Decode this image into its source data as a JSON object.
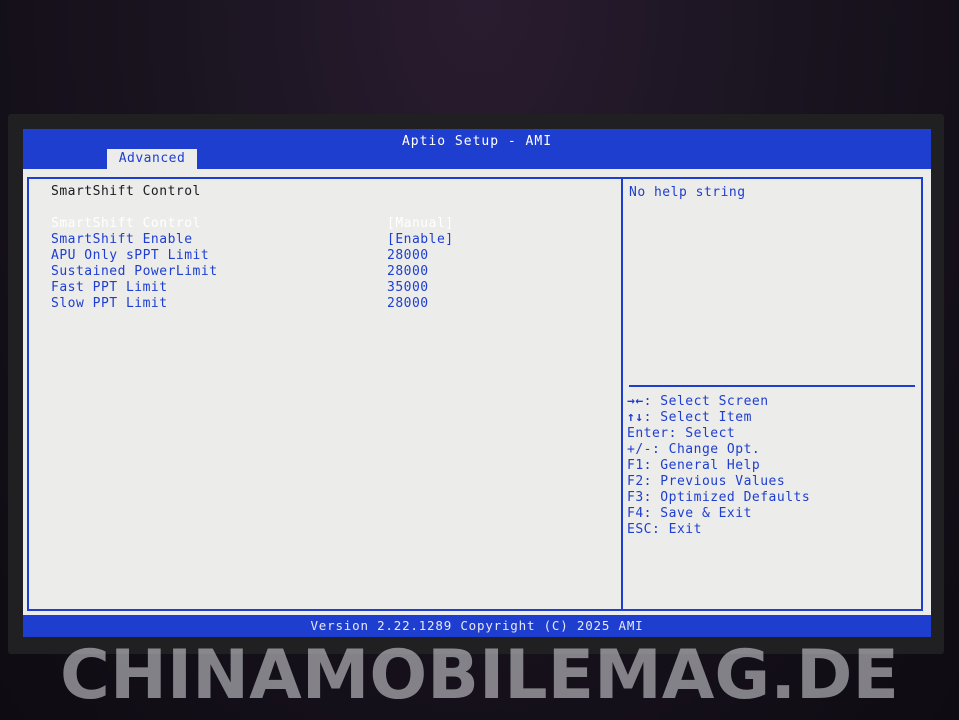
{
  "window": {
    "title": "Aptio Setup - AMI"
  },
  "tabs": [
    {
      "label": "Advanced",
      "active": true
    }
  ],
  "main": {
    "section_title": "SmartShift Control",
    "settings": [
      {
        "label": "SmartShift Control",
        "value": "[Manual]",
        "selected": true
      },
      {
        "label": "SmartShift Enable",
        "value": "[Enable]",
        "selected": false
      },
      {
        "label": "APU Only sPPT Limit",
        "value": "28000",
        "selected": false
      },
      {
        "label": "Sustained PowerLimit",
        "value": "28000",
        "selected": false
      },
      {
        "label": "Fast PPT Limit",
        "value": "35000",
        "selected": false
      },
      {
        "label": "Slow PPT Limit",
        "value": "28000",
        "selected": false
      }
    ]
  },
  "help": {
    "text": "No help string",
    "keys": [
      {
        "key": "→←",
        "desc": ": Select Screen",
        "icon": "arrows-left-right-icon"
      },
      {
        "key": "↑↓",
        "desc": ": Select Item",
        "icon": "arrows-up-down-icon"
      },
      {
        "key": "Enter",
        "desc": ": Select"
      },
      {
        "key": "+/-",
        "desc": ": Change Opt."
      },
      {
        "key": "F1",
        "desc": ": General Help"
      },
      {
        "key": "F2",
        "desc": ": Previous Values"
      },
      {
        "key": "F3",
        "desc": ": Optimized Defaults"
      },
      {
        "key": "F4",
        "desc": ": Save & Exit"
      },
      {
        "key": "ESC",
        "desc": ": Exit"
      }
    ]
  },
  "footer": {
    "text": "Version 2.22.1289 Copyright (C) 2025 AMI"
  },
  "watermark": {
    "text": "CHINAMOBILEMAG.DE"
  },
  "colors": {
    "bios_blue": "#1e3ed0",
    "panel_bg": "#ececea",
    "selected_text": "#ffffff"
  }
}
